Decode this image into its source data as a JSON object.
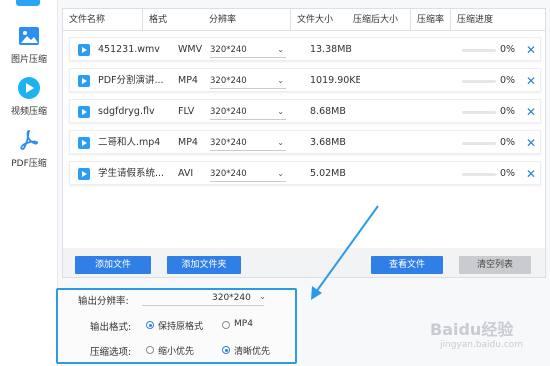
{
  "sidebar": {
    "items": [
      {
        "label": "图片压缩",
        "icon": "image-icon",
        "active": false
      },
      {
        "label": "视频压缩",
        "icon": "play-circle-icon",
        "active": true
      },
      {
        "label": "PDF压缩",
        "icon": "pdf-icon",
        "active": false
      }
    ]
  },
  "table": {
    "headers": [
      "文件名称",
      "格式",
      "分辨率",
      "文件大小",
      "压缩后大小",
      "压缩率",
      "压缩进度"
    ],
    "rows": [
      {
        "name": "451231.wmv",
        "format": "WMV",
        "resolution": "320*240",
        "size": "13.38MB",
        "progress": "0%",
        "progress_value": 0
      },
      {
        "name": "PDF分割演讲...",
        "format": "MP4",
        "resolution": "320*240",
        "size": "1019.90KE",
        "progress": "0%",
        "progress_value": 0
      },
      {
        "name": "sdgfdryg.flv",
        "format": "FLV",
        "resolution": "320*240",
        "size": "8.68MB",
        "progress": "0%",
        "progress_value": 0
      },
      {
        "name": "二哥和人.mp4",
        "format": "MP4",
        "resolution": "320*240",
        "size": "3.68MB",
        "progress": "0%",
        "progress_value": 0
      },
      {
        "name": "学生请假系统...",
        "format": "AVI",
        "resolution": "320*240",
        "size": "5.02MB",
        "progress": "0%",
        "progress_value": 0
      }
    ]
  },
  "actions": {
    "add_file": "添加文件",
    "add_folder": "添加文件夹",
    "view_file": "查看文件",
    "clear_list": "清空列表"
  },
  "settings": {
    "resolution_label": "输出分辨率:",
    "resolution_value": "320*240",
    "format_label": "输出格式:",
    "format_options": [
      {
        "label": "保持原格式",
        "selected": true
      },
      {
        "label": "MP4",
        "selected": false
      }
    ],
    "compress_label": "压缩选项:",
    "compress_options": [
      {
        "label": "缩小优先",
        "selected": false
      },
      {
        "label": "清晰优先",
        "selected": true
      }
    ]
  },
  "watermark": {
    "brand": "Baidu经验",
    "url": "jingyan.baidu.com"
  },
  "colors": {
    "accent": "#2f7fe6",
    "highlight": "#2b9be8",
    "play": "#2a9df4"
  }
}
